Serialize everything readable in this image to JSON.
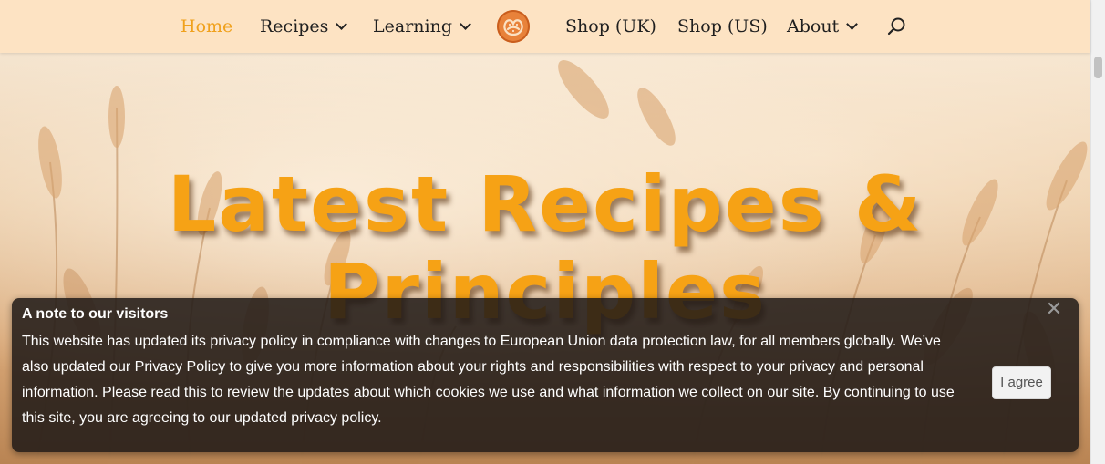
{
  "nav": {
    "items": [
      {
        "label": "Home",
        "active": true,
        "has_dropdown": false
      },
      {
        "label": "Recipes",
        "active": false,
        "has_dropdown": true
      },
      {
        "label": "Learning",
        "active": false,
        "has_dropdown": true
      },
      {
        "label": "Shop (UK)",
        "active": false,
        "has_dropdown": false
      },
      {
        "label": "Shop (US)",
        "active": false,
        "has_dropdown": false
      },
      {
        "label": "About",
        "active": false,
        "has_dropdown": true
      }
    ],
    "logo_icon": "pretzel-icon",
    "search_icon": "search-icon"
  },
  "hero": {
    "title_line1": "Latest Recipes &",
    "title_line2": "Principles",
    "background": "wheat-field-photo"
  },
  "notice": {
    "title": "A note to our visitors",
    "body": "This website has updated its privacy policy in compliance with changes to European Union data protection law, for all members globally. We’ve also updated our Privacy Policy to give you more information about your rights and responsibilities with respect to your privacy and personal information. Please read this to review the updates about which cookies we use and what information we collect on our site. By continuing to use this site, you are agreeing to our updated privacy policy.",
    "agree_label": "I agree",
    "close_icon": "close-icon"
  },
  "colors": {
    "accent": "#f6a215",
    "header_bg": "#fde3c3",
    "notice_bg": "#1e1816"
  }
}
